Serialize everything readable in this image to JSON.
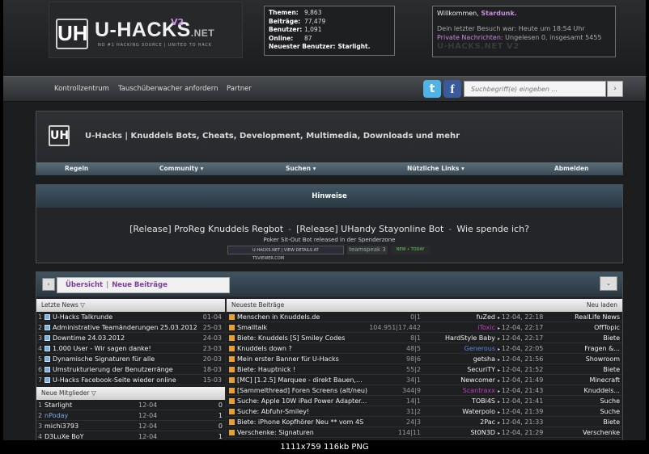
{
  "logo": {
    "name": "U-HACKS",
    "net": ".NET",
    "version": "V2",
    "tagline": "NO #1 HACKING SOURCE | UNITED TO HACK"
  },
  "stats": [
    {
      "label": "Themen:",
      "value": "9,863"
    },
    {
      "label": "Beiträge:",
      "value": "77,479"
    },
    {
      "label": "Benutzer:",
      "value": "1,091"
    },
    {
      "label": "Online:",
      "value": "87"
    },
    {
      "label": "Neuester Benutzer:",
      "value": "Starlight."
    }
  ],
  "welcome": {
    "greeting": "Willkommen,",
    "user": "Stardunk.",
    "last_visit": "Dein letzter Besuch war: Heute um 18:54 Uhr",
    "pm_label": "Private Nachrichten:",
    "pm_value": " Ungelesen 0, insgesamt 5455",
    "brand": "U-HACKS.NET V2"
  },
  "nav": {
    "items": [
      "Kontrollzentrum",
      "Tauschüberwacher anfordern",
      "Partner"
    ],
    "search_placeholder": "Suchbegriff(e) eingeben ...",
    "search_go": "›"
  },
  "banner": {
    "title": "U-Hacks | Knuddels Bots, Cheats, Development, Multimedia, Downloads und mehr",
    "subnav": [
      "Regeln",
      "Community ▾",
      "Suchen ▾",
      "Nützliche Links ▾",
      "Abmelden"
    ]
  },
  "hinweise": {
    "title": "Hinweise",
    "links": [
      "[Release] ProReg Knuddels Regbot",
      "[Release] UHandy Stayonline Bot",
      "Wie spende ich?"
    ],
    "sep": "-",
    "sub": "Poker Sit-Out Bot released in der Spenderzone",
    "badge1": "U-HACKS.NET | VIEW DETAILS AT TSVIEWER.COM",
    "badge2": "teamspeak 3",
    "badge3": "NEW • TODAY"
  },
  "forum": {
    "tab_left": "Übersicht",
    "tab_sep": "|",
    "tab_right": "Neue Beiträge",
    "latest_news_header": "Letzte News ▽",
    "news": [
      {
        "n": "1",
        "title": "U-Hacks Talkrunde",
        "date": "01-04"
      },
      {
        "n": "2",
        "title": "Administrative Teamänderungen 25.03.2012",
        "date": "25-03"
      },
      {
        "n": "3",
        "title": "Downtime 24.03.2012",
        "date": "24-03"
      },
      {
        "n": "4",
        "title": "1.000 User - Wir sagen danke!",
        "date": "23-03"
      },
      {
        "n": "5",
        "title": "Dynamische Signaturen für alle",
        "date": "20-03"
      },
      {
        "n": "6",
        "title": "Umstrukturierung der Benutzerränge",
        "date": "18-03"
      },
      {
        "n": "7",
        "title": "U-Hacks Facebook-Seite wieder online",
        "date": "15-03"
      }
    ],
    "new_members_header": "Neue Mitglieder ▽",
    "members": [
      {
        "n": "1",
        "user": "Starlight",
        "date": "12-04",
        "count": "0",
        "color": "#f0f0f0"
      },
      {
        "n": "2",
        "user": "nPoday",
        "date": "12-04",
        "count": "1",
        "color": "#7aa8e8"
      },
      {
        "n": "3",
        "user": "michi3793",
        "date": "12-04",
        "count": "0",
        "color": "#f0f0f0"
      },
      {
        "n": "4",
        "user": "D3LuXe BoY",
        "date": "12-04",
        "count": "1",
        "color": "#f0f0f0"
      }
    ],
    "posts_header": "Neueste Beiträge",
    "reload": "Neu laden",
    "posts": [
      {
        "title": "Menschen in Knuddels.de",
        "stats": "0|1",
        "author": "fuZed",
        "author_color": "#f0f0f0",
        "time": "12-04, 22:18",
        "forum": "RealLife News"
      },
      {
        "title": "Smalltalk",
        "stats": "104.951|17.442",
        "author": "iToxic",
        "author_color": "#c040c0",
        "time": "12-04, 22:17",
        "forum": "OffTopic"
      },
      {
        "title": "Biete: Knuddels [S] Smiley Codes",
        "stats": "8|1",
        "author": "HardStyle Baby",
        "author_color": "#f0f0f0",
        "time": "12-04, 22:17",
        "forum": "Biete"
      },
      {
        "title": "Knuddels down ?",
        "stats": "48|5",
        "author": "Generous",
        "author_color": "#5a8ad8",
        "time": "12-04, 22:05",
        "forum": "Fragen &..."
      },
      {
        "title": "Mein erster Banner für U-Hacks",
        "stats": "98|6",
        "author": "getsha",
        "author_color": "#f0f0f0",
        "time": "12-04, 21:56",
        "forum": "Showroom"
      },
      {
        "title": "Biete: Hauptnick !",
        "stats": "55|2",
        "author": "SecuriTY",
        "author_color": "#f0f0f0",
        "time": "12-04, 21:52",
        "forum": "Biete"
      },
      {
        "title": "[MC] [1.2.5] Marquee - direkt Bauen,...",
        "stats": "34|1",
        "author": "Newcomer",
        "author_color": "#f0f0f0",
        "time": "12-04, 21:49",
        "forum": "Minecraft"
      },
      {
        "title": "[Sammelthread] Foren Screens (alt/neu)",
        "stats": "344|9",
        "author": "Scantraxx",
        "author_color": "#c040c0",
        "time": "12-04, 21:43",
        "forum": "Knuddels..."
      },
      {
        "title": "Suche: Apple 10W iPad Power Adapter...",
        "stats": "14|1",
        "author": "TOBi4S",
        "author_color": "#f0f0f0",
        "time": "12-04, 21:41",
        "forum": "Suche"
      },
      {
        "title": "Suche: Abfuhr-Smiley!",
        "stats": "31|2",
        "author": "Waterpolo",
        "author_color": "#f0f0f0",
        "time": "12-04, 21:39",
        "forum": "Suche"
      },
      {
        "title": "Biete: iPhone Kopfhörer Neu ** vom 4S",
        "stats": "24|3",
        "author": "2Pac",
        "author_color": "#f0f0f0",
        "time": "12-04, 21:33",
        "forum": "Biete"
      },
      {
        "title": "Verschenke: Signaturen",
        "stats": "114|11",
        "author": "St0N3D",
        "author_color": "#f0f0f0",
        "time": "12-04, 21:29",
        "forum": "Verschenke"
      }
    ]
  },
  "caption": "1111x759  116kb  PNG"
}
